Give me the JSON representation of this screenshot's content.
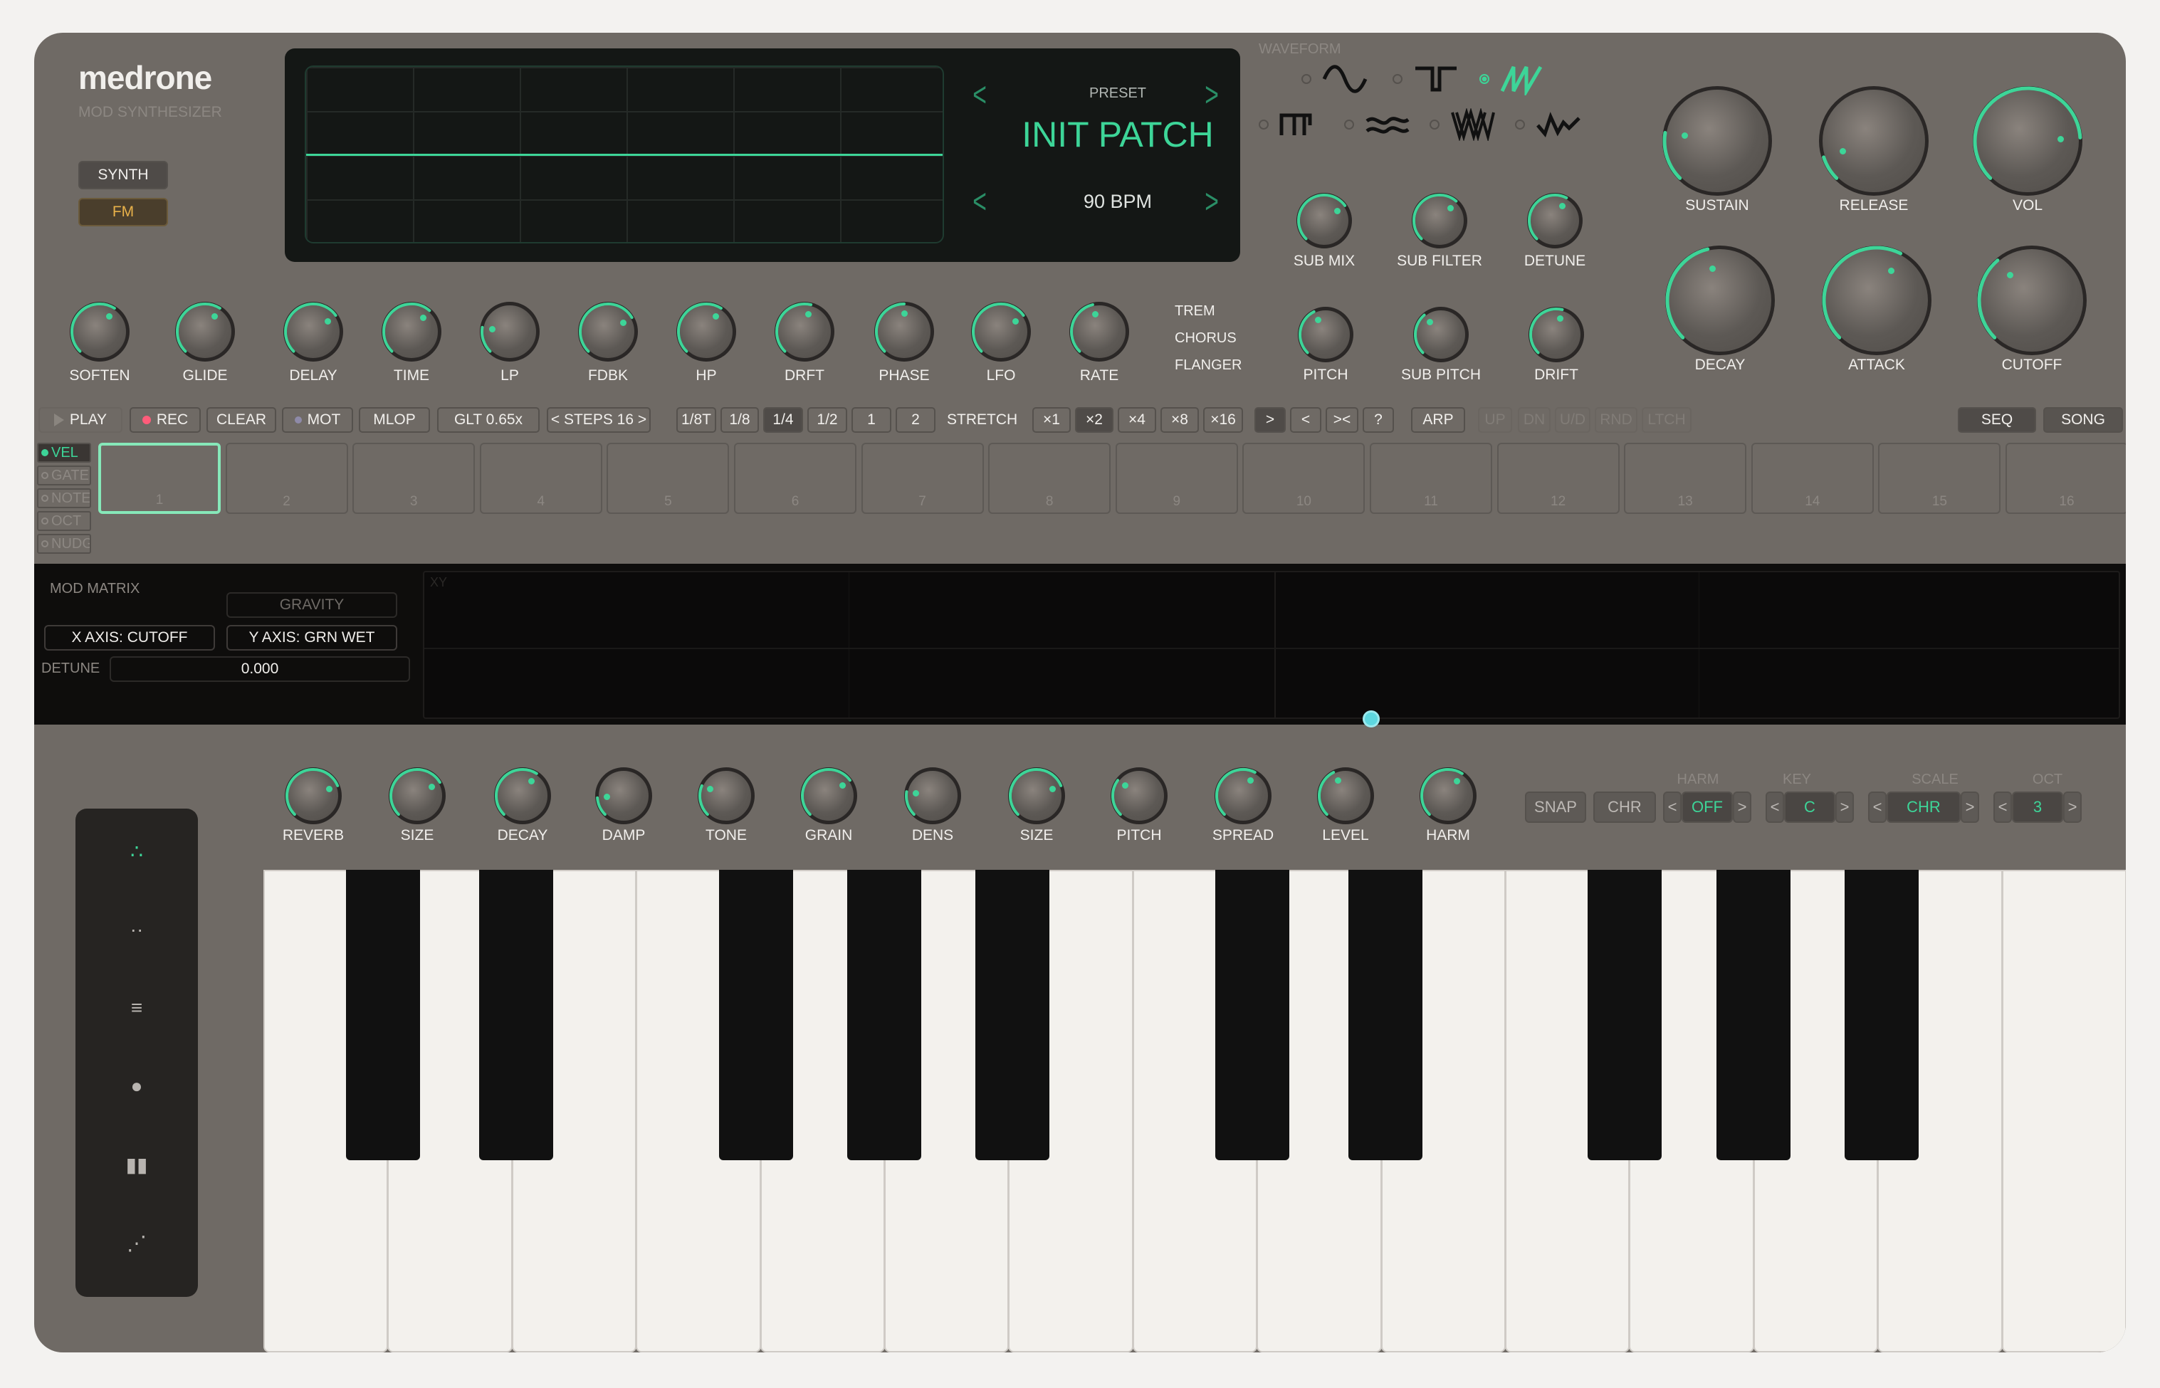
{
  "brand": {
    "name": "medrone",
    "subtitle": "MOD SYNTHESIZER"
  },
  "modes": [
    {
      "label": "SYNTH",
      "active": false
    },
    {
      "label": "FM",
      "active": true
    }
  ],
  "display": {
    "preset_label": "PRESET",
    "preset_name": "INIT PATCH",
    "bpm": "90 BPM"
  },
  "waveform": {
    "title": "WAVEFORM",
    "options": [
      "sine",
      "square",
      "saw",
      "pulse",
      "noise",
      "supersaw",
      "wobble"
    ],
    "selected": "saw"
  },
  "knobs_top": [
    {
      "label": "SOFTEN"
    },
    {
      "label": "GLIDE"
    },
    {
      "label": "DELAY"
    },
    {
      "label": "TIME"
    },
    {
      "label": "LP"
    },
    {
      "label": "FDBK"
    },
    {
      "label": "HP"
    },
    {
      "label": "DRFT"
    },
    {
      "label": "PHASE"
    },
    {
      "label": "LFO"
    },
    {
      "label": "RATE"
    }
  ],
  "fx_list": [
    "TREM",
    "CHORUS",
    "FLANGER"
  ],
  "knobs_sub": [
    {
      "label": "SUB MIX"
    },
    {
      "label": "SUB FILTER"
    },
    {
      "label": "DETUNE"
    },
    {
      "label": "PITCH"
    },
    {
      "label": "SUB PITCH"
    },
    {
      "label": "DRIFT"
    }
  ],
  "knobs_env": [
    {
      "label": "SUSTAIN"
    },
    {
      "label": "RELEASE"
    },
    {
      "label": "VOL"
    },
    {
      "label": "DECAY"
    },
    {
      "label": "ATTACK"
    },
    {
      "label": "CUTOFF"
    }
  ],
  "transport": {
    "play": "PLAY",
    "rec": "REC",
    "clear": "CLEAR",
    "mot": "MOT",
    "mlop": "MLOP",
    "glt": "GLT 0.65x",
    "steps": "< STEPS 16 >",
    "divisions": [
      "1/8T",
      "1/8",
      "1/4",
      "1/2",
      "1",
      "2"
    ],
    "division_selected": "1/4",
    "stretch_label": "STRETCH",
    "stretch": [
      "×1",
      "×2",
      "×4",
      "×8",
      "×16"
    ],
    "stretch_selected": "×2",
    "dirs": [
      ">",
      "<",
      "><",
      "?"
    ],
    "arp": "ARP",
    "arp_modes": [
      "UP",
      "DN",
      "U/D",
      "RND",
      "LTCH"
    ],
    "seq": "SEQ",
    "song": "SONG"
  },
  "lanes": [
    {
      "label": "VEL",
      "active": true
    },
    {
      "label": "GATE",
      "active": false
    },
    {
      "label": "NOTE",
      "active": false
    },
    {
      "label": "OCT",
      "active": false
    },
    {
      "label": "NUDGE",
      "active": false
    }
  ],
  "steps": [
    "1",
    "2",
    "3",
    "4",
    "5",
    "6",
    "7",
    "8",
    "9",
    "10",
    "11",
    "12",
    "13",
    "14",
    "15",
    "16"
  ],
  "selected_step": "1",
  "mod_matrix": {
    "title": "MOD MATRIX",
    "gravity": "GRAVITY",
    "x_axis": "X AXIS: CUTOFF",
    "y_axis": "Y AXIS: GRN WET",
    "param_label": "DETUNE",
    "param_value": "0.000",
    "xy_label": "XY"
  },
  "knobs_fx": [
    {
      "label": "REVERB"
    },
    {
      "label": "SIZE"
    },
    {
      "label": "DECAY"
    },
    {
      "label": "DAMP"
    },
    {
      "label": "TONE"
    },
    {
      "label": "GRAIN"
    },
    {
      "label": "DENS"
    },
    {
      "label": "SIZE"
    },
    {
      "label": "PITCH"
    },
    {
      "label": "SPREAD"
    },
    {
      "label": "LEVEL"
    },
    {
      "label": "HARM"
    }
  ],
  "harmony": {
    "snap": "SNAP",
    "chr": "CHR",
    "harm_label": "HARM",
    "harm_value": "OFF",
    "key_label": "KEY",
    "key_value": "C",
    "scale_label": "SCALE",
    "scale_value": "CHR",
    "oct_label": "OCT",
    "oct_value": "3",
    "prev": "<",
    "next": ">"
  },
  "sidebar_icons": [
    "dots-triangle-icon",
    "dots-pair-icon",
    "menu-lines-icon",
    "record-dot-icon",
    "bars-icon",
    "scatter-icon"
  ],
  "colors": {
    "accent": "#3dd598",
    "panel": "#6f6a65",
    "rec": "#ff5c7a",
    "puck": "#5dd7df"
  }
}
